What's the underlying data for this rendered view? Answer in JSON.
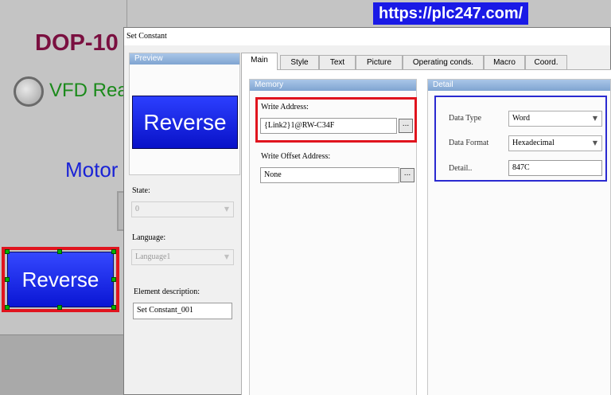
{
  "watermark": "https://plc247.com/",
  "canvas": {
    "title": "DOP-10",
    "vfd_label": "VFD Rea",
    "motor_label": "Motor",
    "button_label": "Reverse"
  },
  "dialog": {
    "title": "Set Constant",
    "preview": {
      "title": "Preview",
      "button_label": "Reverse"
    },
    "state": {
      "label": "State:",
      "value": "0"
    },
    "language": {
      "label": "Language:",
      "value": "Language1"
    },
    "element_description": {
      "label": "Element description:",
      "value": "Set Constant_001"
    },
    "tabs": [
      {
        "label": "Main",
        "active": true
      },
      {
        "label": "Style"
      },
      {
        "label": "Text"
      },
      {
        "label": "Picture"
      },
      {
        "label": "Operating conds."
      },
      {
        "label": "Macro"
      },
      {
        "label": "Coord."
      }
    ],
    "memory": {
      "title": "Memory",
      "write_address_label": "Write Address:",
      "write_address_value": "{Link2}1@RW-C34F",
      "write_offset_label": "Write Offset Address:",
      "write_offset_value": "None",
      "browse_label": "..."
    },
    "detail": {
      "title": "Detail",
      "data_type_label": "Data Type",
      "data_type_value": "Word",
      "data_format_label": "Data Format",
      "data_format_value": "Hexadecimal",
      "detail_label": "Detail..",
      "detail_value": "847C"
    }
  },
  "colors": {
    "highlight_red": "#e0141e",
    "highlight_blue": "#2a2ad0",
    "button_blue": "#0a16d4",
    "watermark_bg": "#1a1ae6"
  }
}
